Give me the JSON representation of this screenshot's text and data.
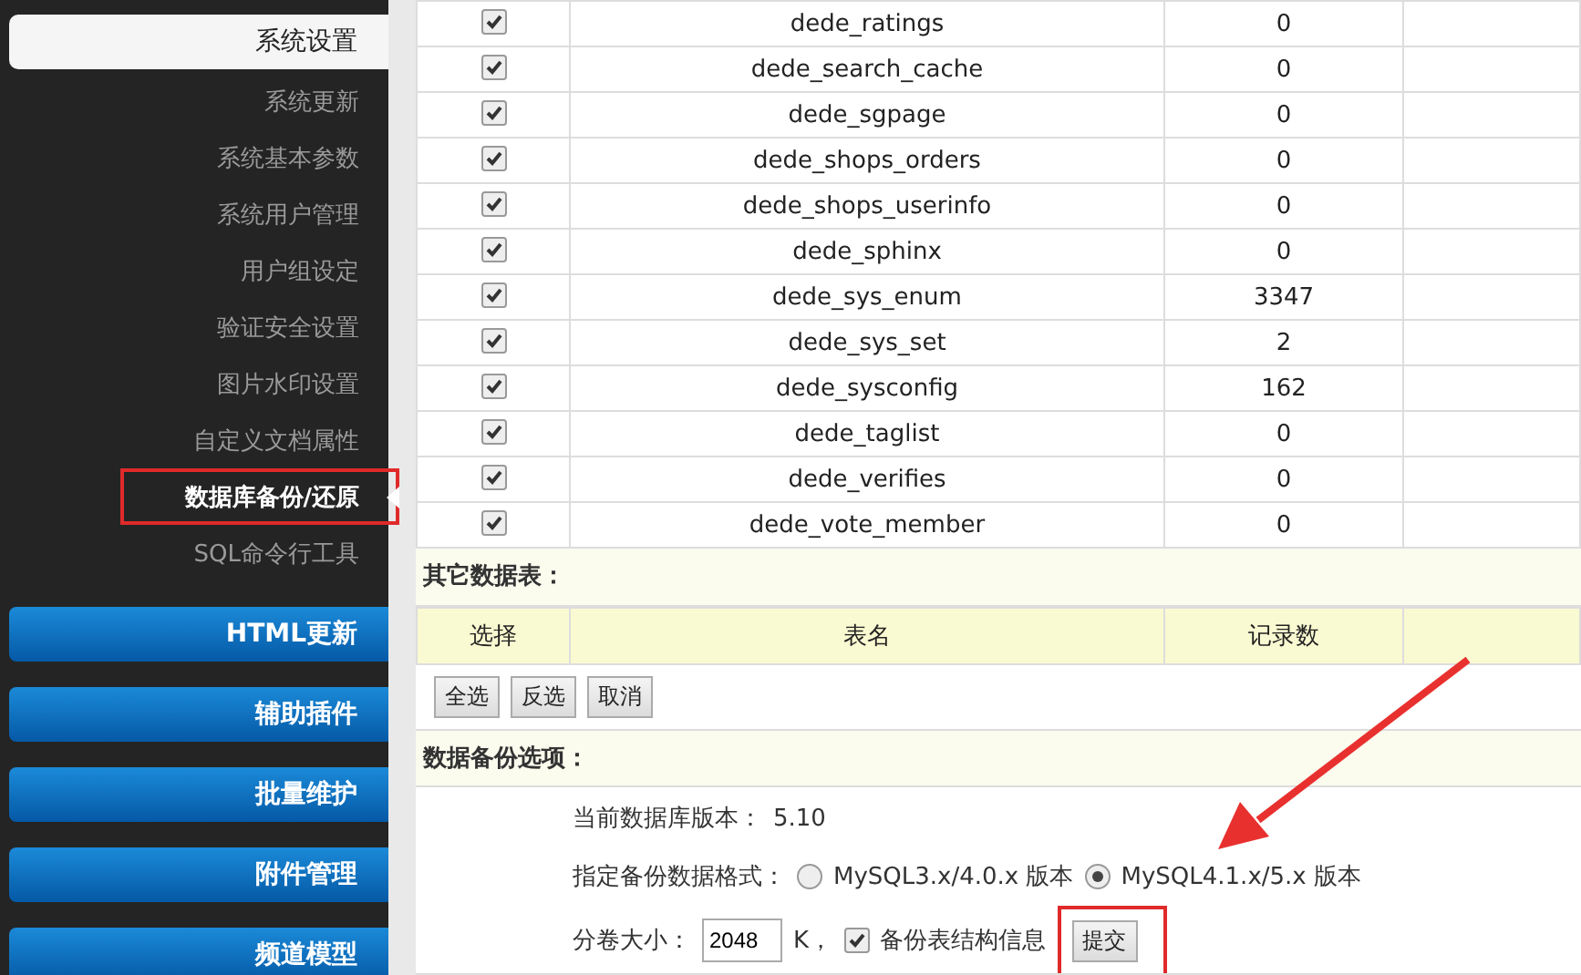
{
  "sidebar": {
    "group": {
      "label": "系统设置",
      "expanded": true
    },
    "items": [
      {
        "label": "系统更新",
        "selected": false,
        "highlighted": false
      },
      {
        "label": "系统基本参数",
        "selected": false,
        "highlighted": false
      },
      {
        "label": "系统用户管理",
        "selected": false,
        "highlighted": false
      },
      {
        "label": "用户组设定",
        "selected": false,
        "highlighted": false
      },
      {
        "label": "验证安全设置",
        "selected": false,
        "highlighted": false
      },
      {
        "label": "图片水印设置",
        "selected": false,
        "highlighted": false
      },
      {
        "label": "自定义文档属性",
        "selected": false,
        "highlighted": false
      },
      {
        "label": "数据库备份/还原",
        "selected": true,
        "highlighted": true
      },
      {
        "label": "SQL命令行工具",
        "selected": false,
        "highlighted": false
      }
    ],
    "groups": [
      {
        "label": "HTML更新"
      },
      {
        "label": "辅助插件"
      },
      {
        "label": "批量维护"
      },
      {
        "label": "附件管理"
      },
      {
        "label": "频道模型"
      }
    ]
  },
  "tables": {
    "rows": [
      {
        "checked": true,
        "name": "dede_ratings",
        "count": "0"
      },
      {
        "checked": true,
        "name": "dede_search_cache",
        "count": "0"
      },
      {
        "checked": true,
        "name": "dede_sgpage",
        "count": "0"
      },
      {
        "checked": true,
        "name": "dede_shops_orders",
        "count": "0"
      },
      {
        "checked": true,
        "name": "dede_shops_userinfo",
        "count": "0"
      },
      {
        "checked": true,
        "name": "dede_sphinx",
        "count": "0"
      },
      {
        "checked": true,
        "name": "dede_sys_enum",
        "count": "3347"
      },
      {
        "checked": true,
        "name": "dede_sys_set",
        "count": "2"
      },
      {
        "checked": true,
        "name": "dede_sysconfig",
        "count": "162"
      },
      {
        "checked": true,
        "name": "dede_taglist",
        "count": "0"
      },
      {
        "checked": true,
        "name": "dede_verifies",
        "count": "0"
      },
      {
        "checked": true,
        "name": "dede_vote_member",
        "count": "0"
      }
    ]
  },
  "other_tables": {
    "title": "其它数据表：",
    "columns": [
      "选择",
      "表名",
      "记录数"
    ],
    "buttons": [
      "全选",
      "反选",
      "取消"
    ]
  },
  "backup_options": {
    "title": "数据备份选项：",
    "version_label": "当前数据库版本：",
    "version": "5.10",
    "format_label": "指定备份数据格式：",
    "formats": [
      {
        "label": "MySQL3.x/4.0.x 版本",
        "selected": false
      },
      {
        "label": "MySQL4.1.x/5.x 版本",
        "selected": true
      }
    ],
    "volume_label": "分卷大小：",
    "volume_size": "2048",
    "volume_unit": "K，",
    "structure": {
      "label": "备份表结构信息",
      "checked": true
    },
    "submit": {
      "label": "提交",
      "highlighted": true
    }
  }
}
